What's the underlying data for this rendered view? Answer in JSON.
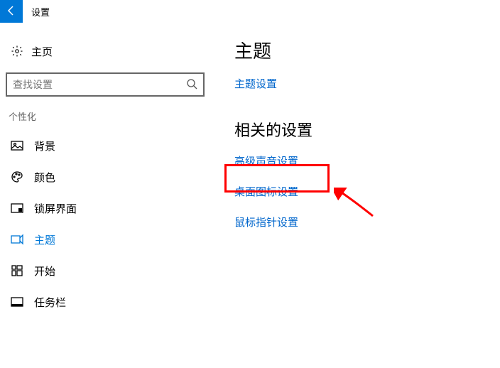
{
  "titlebar": {
    "label": "设置"
  },
  "sidebar": {
    "home": "主页",
    "search_placeholder": "查找设置",
    "section": "个性化",
    "items": [
      {
        "label": "背景"
      },
      {
        "label": "颜色"
      },
      {
        "label": "锁屏界面"
      },
      {
        "label": "主题"
      },
      {
        "label": "开始"
      },
      {
        "label": "任务栏"
      }
    ]
  },
  "main": {
    "heading1": "主题",
    "link_theme_settings": "主题设置",
    "heading2": "相关的设置",
    "link_sound": "高级声音设置",
    "link_desktop_icons": "桌面图标设置",
    "link_mouse": "鼠标指针设置"
  }
}
